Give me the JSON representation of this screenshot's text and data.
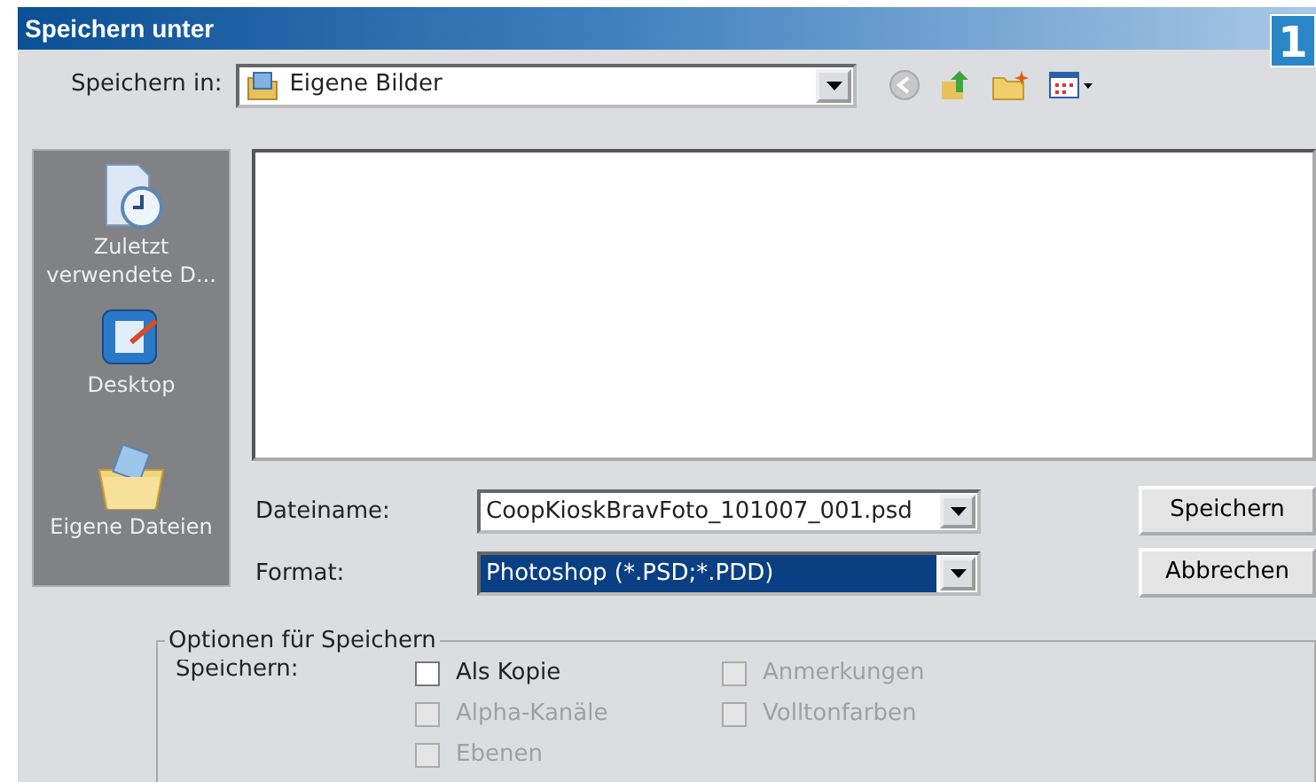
{
  "window": {
    "title": "Speichern unter",
    "figure_number": "1"
  },
  "save_in": {
    "label": "Speichern in:",
    "value": "Eigene Bilder"
  },
  "places": [
    {
      "label": "Zuletzt verwendete D...",
      "kind": "recent"
    },
    {
      "label": "Desktop",
      "kind": "desktop"
    },
    {
      "label": "Eigene Dateien",
      "kind": "documents"
    }
  ],
  "filename": {
    "label": "Dateiname:",
    "value": "CoopKioskBravFoto_101007_001.psd",
    "selected": false
  },
  "format": {
    "label": "Format:",
    "value": "Photoshop (*.PSD;*.PDD)",
    "selected": true
  },
  "buttons": [
    "Speichern",
    "Abbrechen"
  ],
  "options": {
    "title": "Optionen für Speichern",
    "label": "Speichern:",
    "checkboxes": [
      {
        "label": "Als Kopie",
        "checked": false,
        "disabled": false
      },
      {
        "label": "Anmerkungen",
        "checked": false,
        "disabled": true
      },
      {
        "label": "Alpha-Kanäle",
        "checked": false,
        "disabled": true
      },
      {
        "label": "Volltonfarben",
        "checked": false,
        "disabled": true
      },
      {
        "label": "Ebenen",
        "checked": false,
        "disabled": true
      }
    ]
  }
}
